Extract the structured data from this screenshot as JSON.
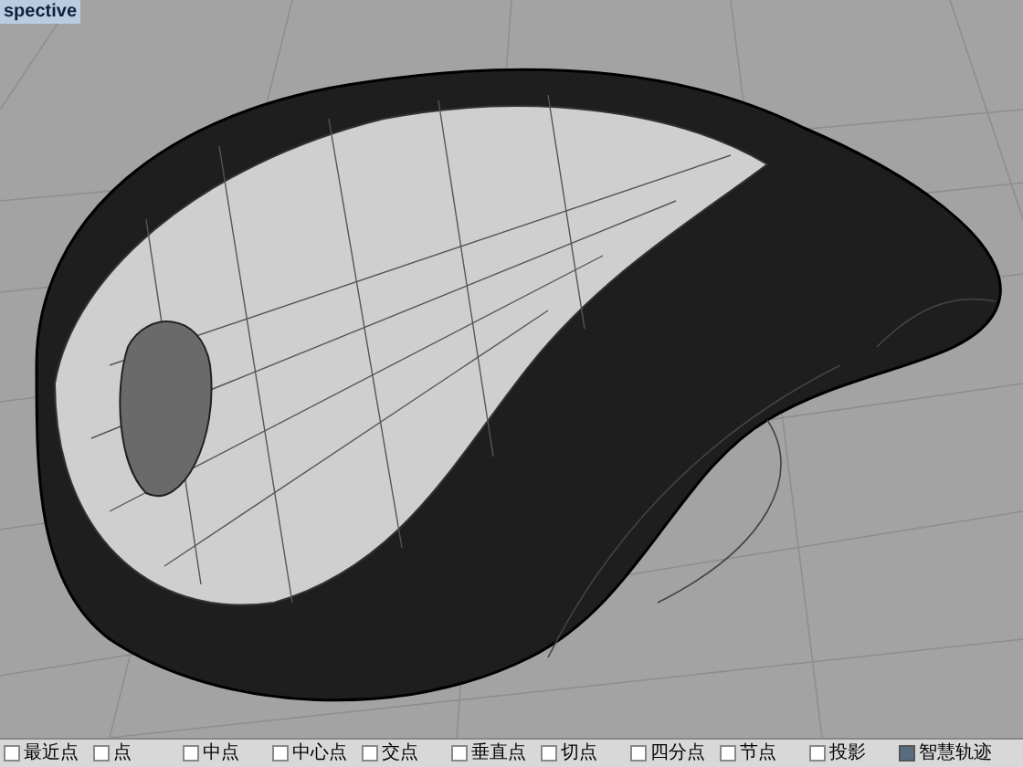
{
  "viewport": {
    "title": "spective"
  },
  "osnaps": [
    {
      "label": "最近点",
      "checked": false
    },
    {
      "label": "点",
      "checked": false
    },
    {
      "label": "中点",
      "checked": false
    },
    {
      "label": "中心点",
      "checked": false
    },
    {
      "label": "交点",
      "checked": false
    },
    {
      "label": "垂直点",
      "checked": false
    },
    {
      "label": "切点",
      "checked": false
    },
    {
      "label": "四分点",
      "checked": false
    },
    {
      "label": "节点",
      "checked": false
    },
    {
      "label": "投影",
      "checked": false
    },
    {
      "label": "智慧轨迹",
      "checked": true
    }
  ]
}
